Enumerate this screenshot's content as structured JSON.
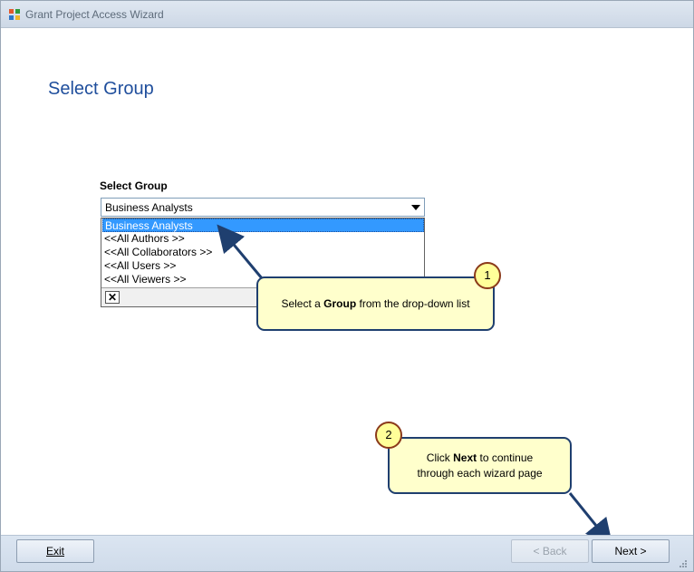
{
  "window": {
    "title": "Grant Project Access Wizard"
  },
  "page": {
    "title": "Select Group"
  },
  "group_field": {
    "label": "Select Group",
    "value": "Business Analysts",
    "options": [
      "Business Analysts",
      "<<All Authors >>",
      "<<All Collaborators >>",
      "<<All Users >>",
      "<<All Viewers >>"
    ],
    "close_glyph": "✕"
  },
  "callouts": [
    {
      "number": "1",
      "text_before": "Select a ",
      "bold": "Group",
      "text_after": " from the drop-down list"
    },
    {
      "number": "2",
      "line1_before": "Click ",
      "line1_bold": "Next",
      "line1_after": " to continue",
      "line2": "through each wizard page"
    }
  ],
  "footer": {
    "exit_label": "Exit",
    "back_label": "< Back",
    "next_label": "Next >"
  },
  "colors": {
    "title_blue": "#1f4e9c",
    "callout_fill": "#ffffcc",
    "callout_border": "#1f3f6f",
    "badge_fill": "#ffff99",
    "selection": "#3399ff"
  }
}
